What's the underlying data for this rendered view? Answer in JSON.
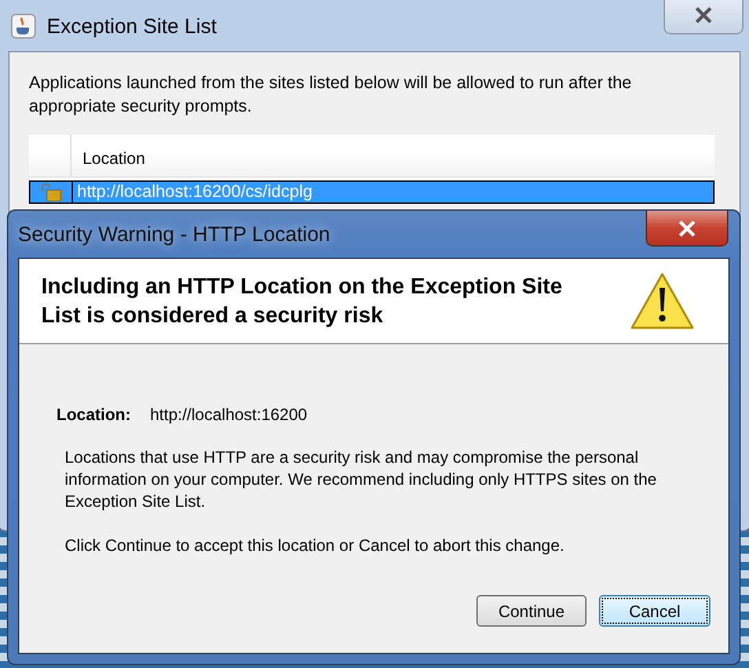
{
  "site_list_window": {
    "title": "Exception Site List",
    "description": "Applications launched from the sites listed below will be allowed to run after the appropriate security prompts.",
    "table": {
      "columns": [
        "Location"
      ],
      "rows": [
        {
          "location": "http://localhost:16200/cs/idcplg",
          "selected": true
        }
      ]
    }
  },
  "security_dialog": {
    "title": "Security Warning - HTTP Location",
    "heading": "Including an HTTP Location on the Exception Site List is considered a security risk",
    "location_label": "Location:",
    "location_value": "http://localhost:16200",
    "paragraphs": [
      "Locations that use HTTP are a security risk and may compromise the personal information on your computer.  We recommend including only HTTPS sites on the Exception Site List.",
      "Click Continue to accept this location or Cancel to abort this change."
    ],
    "buttons": [
      {
        "label": "Continue",
        "focused": false
      },
      {
        "label": "Cancel",
        "focused": true
      }
    ]
  }
}
